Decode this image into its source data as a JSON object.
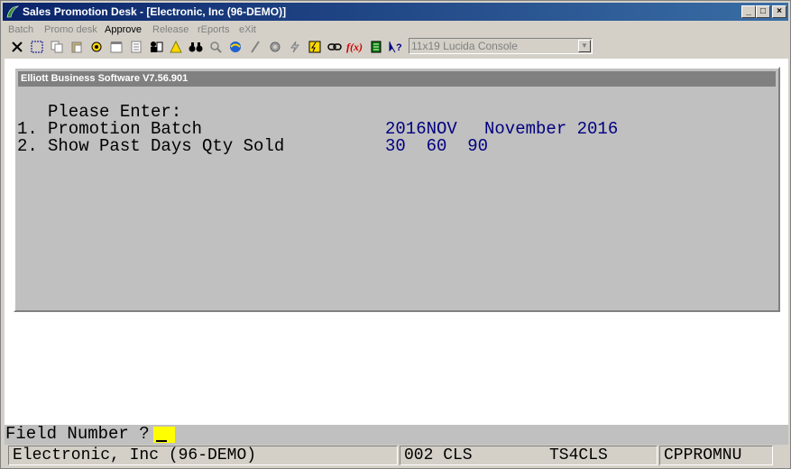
{
  "window": {
    "title": "Sales Promotion Desk - [Electronic, Inc (96-DEMO)]",
    "buttons": {
      "minimize": "_",
      "maximize": "□",
      "close": "×"
    }
  },
  "menu": [
    {
      "label": "Batch",
      "enabled": false
    },
    {
      "label": "Promo desk",
      "enabled": false
    },
    {
      "label": "Approve",
      "enabled": true
    },
    {
      "label": "Release",
      "enabled": false
    },
    {
      "label": "rEports",
      "enabled": false
    },
    {
      "label": "eXit",
      "enabled": false
    }
  ],
  "toolbar": {
    "font_combo": "11x19 Lucida Console",
    "icons": [
      "exit-icon",
      "select-icon",
      "copy-icon",
      "paste-icon",
      "print-icon",
      "settings-icon",
      "properties-icon",
      "notes-icon",
      "users-icon",
      "alert-icon",
      "binoculars-icon",
      "magnify-icon",
      "web-icon",
      "pen-icon",
      "gear-icon",
      "lightning-icon",
      "calc-icon",
      "link-icon",
      "function-icon",
      "book-icon",
      "help-icon"
    ],
    "function_label": "f(x)"
  },
  "panel": {
    "header": "Elliott Business Software V7.56.901",
    "prompt": "Please Enter:",
    "fields": [
      {
        "number": "1.",
        "label": "Promotion Batch",
        "value": "2016NOV",
        "description": "November 2016"
      },
      {
        "number": "2.",
        "label": "Show Past Days Qty Sold",
        "value": "30  60  90"
      }
    ]
  },
  "prompt_line": {
    "text": "Field Number ? "
  },
  "status": {
    "company": "Electronic, Inc (96-DEMO)",
    "code": "002 CLS",
    "terminal": "TS4CLS",
    "program": "CPPROMNU"
  }
}
